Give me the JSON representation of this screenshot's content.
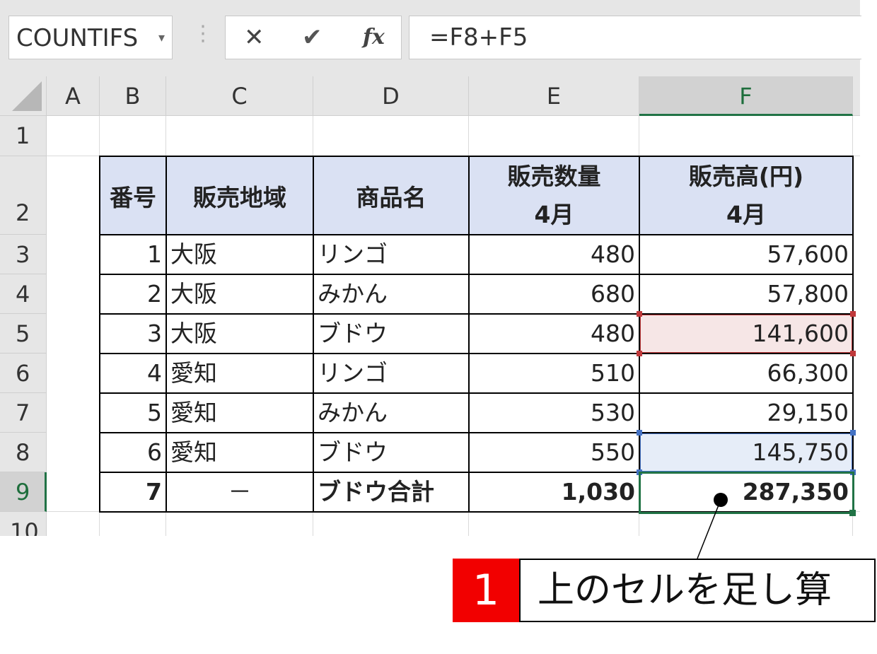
{
  "namebox": {
    "value": "COUNTIFS",
    "dropdown_icon": "caret-down-icon"
  },
  "formula_bar": {
    "cancel_icon": "✕",
    "enter_icon": "✔",
    "fx_label": "fx",
    "formula": "=F8+F5"
  },
  "columns": [
    "A",
    "B",
    "C",
    "D",
    "E",
    "F"
  ],
  "rows": [
    "1",
    "2",
    "3",
    "4",
    "5",
    "6",
    "7",
    "8",
    "9",
    "10"
  ],
  "table": {
    "headers": {
      "no": "番号",
      "region": "販売地域",
      "product": "商品名",
      "qty_line1": "販売数量",
      "qty_line2": "4月",
      "sales_line1": "販売高(円)",
      "sales_line2": "4月"
    },
    "rows": [
      {
        "no": "1",
        "region": "大阪",
        "product": "リンゴ",
        "qty": "480",
        "sales": "57,600"
      },
      {
        "no": "2",
        "region": "大阪",
        "product": "みかん",
        "qty": "680",
        "sales": "57,800"
      },
      {
        "no": "3",
        "region": "大阪",
        "product": "ブドウ",
        "qty": "480",
        "sales": "141,600"
      },
      {
        "no": "4",
        "region": "愛知",
        "product": "リンゴ",
        "qty": "510",
        "sales": "66,300"
      },
      {
        "no": "5",
        "region": "愛知",
        "product": "みかん",
        "qty": "530",
        "sales": "29,150"
      },
      {
        "no": "6",
        "region": "愛知",
        "product": "ブドウ",
        "qty": "550",
        "sales": "145,750"
      }
    ],
    "total": {
      "no": "7",
      "region": "－",
      "product": "ブドウ合計",
      "qty": "1,030",
      "sales": "287,350"
    }
  },
  "colors": {
    "selection": "#217346",
    "ref_red": "#c0393b",
    "ref_blue": "#4472c4",
    "header_fill": "#dae1f3",
    "badge": "#f20000"
  },
  "callout": {
    "number": "1",
    "text": "上のセルを足し算"
  }
}
